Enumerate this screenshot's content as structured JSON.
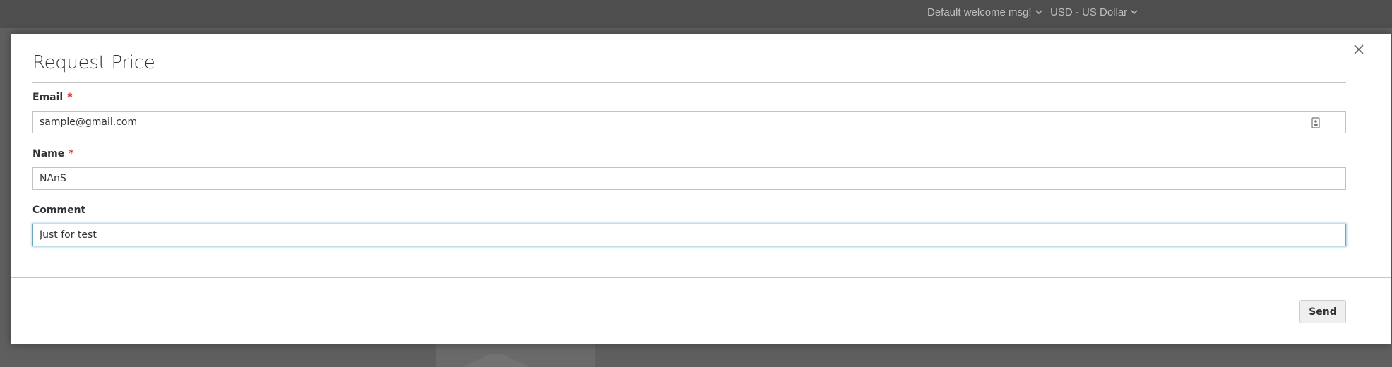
{
  "header": {
    "welcome_msg": "Default welcome msg!",
    "currency": "USD - US Dollar",
    "chevron_icon": "chevron-down-icon"
  },
  "modal": {
    "title": "Request Price",
    "close_icon": "close-icon",
    "fields": {
      "email": {
        "label": "Email",
        "required_mark": "*",
        "value": "sample@gmail.com",
        "autofill_icon": "contact-card-icon"
      },
      "name": {
        "label": "Name",
        "required_mark": "*",
        "value": "NAnS"
      },
      "comment": {
        "label": "Comment",
        "value": "Just for test"
      }
    },
    "send_label": "Send"
  },
  "colors": {
    "required": "#e02b27",
    "focus_border": "#6ba6c4",
    "overlay": "#5f5f5f"
  }
}
